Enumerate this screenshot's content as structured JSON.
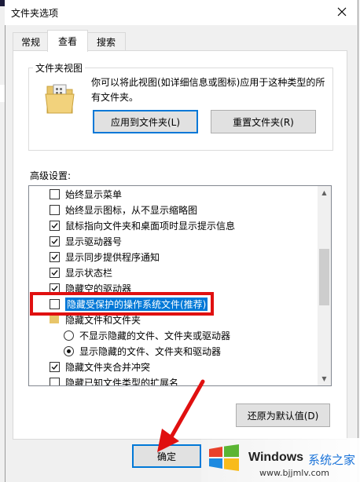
{
  "window": {
    "title": "文件夹选项"
  },
  "tabs": [
    {
      "label": "常规"
    },
    {
      "label": "查看",
      "active": true
    },
    {
      "label": "搜索"
    }
  ],
  "folder_views": {
    "group_label": "文件夹视图",
    "description": "你可以将此视图(如详细信息或图标)应用于这种类型的所有文件夹。",
    "apply_button": "应用到文件夹(L)",
    "reset_button": "重置文件夹(R)"
  },
  "advanced": {
    "label": "高级设置:",
    "items": [
      {
        "type": "checkbox",
        "label": "始终显示菜单",
        "checked": false
      },
      {
        "type": "checkbox",
        "label": "始终显示图标，从不显示缩略图",
        "checked": false
      },
      {
        "type": "checkbox",
        "label": "鼠标指向文件夹和桌面项时显示提示信息",
        "checked": true
      },
      {
        "type": "checkbox",
        "label": "显示驱动器号",
        "checked": true
      },
      {
        "type": "checkbox",
        "label": "显示同步提供程序通知",
        "checked": true
      },
      {
        "type": "checkbox",
        "label": "显示状态栏",
        "checked": true
      },
      {
        "type": "checkbox",
        "label": "隐藏空的驱动器",
        "checked": true
      },
      {
        "type": "checkbox",
        "label": "隐藏受保护的操作系统文件(推荐)",
        "checked": false,
        "selected": true
      },
      {
        "type": "folder",
        "label": "隐藏文件和文件夹"
      },
      {
        "type": "radio",
        "label": "不显示隐藏的文件、文件夹或驱动器",
        "checked": false
      },
      {
        "type": "radio",
        "label": "显示隐藏的文件、文件夹和驱动器",
        "checked": true
      },
      {
        "type": "checkbox",
        "label": "隐藏文件夹合并冲突",
        "checked": true
      },
      {
        "type": "checkbox",
        "label": "隐藏已知文件类型的扩展名",
        "checked": false
      }
    ],
    "restore_button": "还原为默认值(D)"
  },
  "footer": {
    "ok_button": "确定"
  },
  "watermark": {
    "brand": "Windows",
    "brand_cn": "系统之家",
    "url": "www.bjjmlv.com"
  },
  "colors": {
    "accent": "#0078d7",
    "highlight": "#e01010",
    "selection": "#0078d7"
  }
}
